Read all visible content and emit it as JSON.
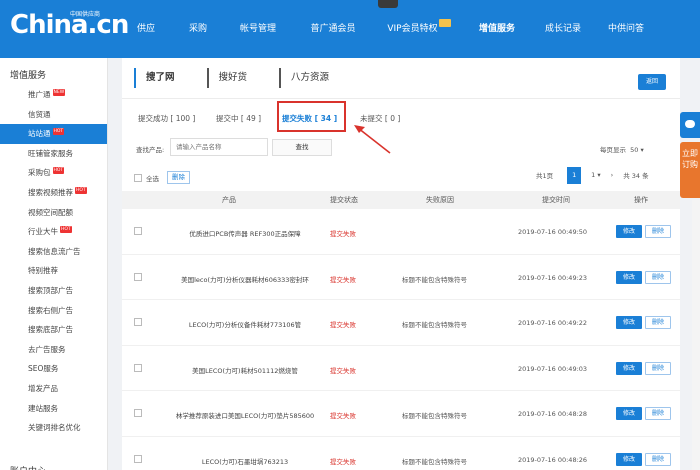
{
  "header": {
    "logo": "China.cn",
    "logo_sub": "中国供应商",
    "nav": [
      {
        "label": "供应",
        "bold": false
      },
      {
        "label": "采购",
        "bold": false
      },
      {
        "label": "帐号管理",
        "bold": false
      },
      {
        "label": "普广通会员",
        "bold": false
      },
      {
        "label": "VIP会员特权",
        "bold": false
      },
      {
        "label": "增值服务",
        "bold": true
      },
      {
        "label": "成长记录",
        "bold": false
      },
      {
        "label": "中供问答",
        "bold": false
      }
    ]
  },
  "sidebar": {
    "section_title": "增值服务",
    "items": [
      {
        "label": "推广通",
        "hot": "NEW",
        "active": false
      },
      {
        "label": "信贸通",
        "hot": "",
        "active": false
      },
      {
        "label": "站站通",
        "hot": "HOT",
        "active": true
      },
      {
        "label": "旺铺管家服务",
        "hot": "",
        "active": false
      },
      {
        "label": "采购包",
        "hot": "HOT",
        "active": false
      },
      {
        "label": "搜索视频推荐",
        "hot": "HOT",
        "active": false
      },
      {
        "label": "视频空间配额",
        "hot": "",
        "active": false
      },
      {
        "label": "行业大牛",
        "hot": "HOT",
        "active": false
      },
      {
        "label": "搜索信息流广告",
        "hot": "",
        "active": false
      },
      {
        "label": "特别推荐",
        "hot": "",
        "active": false
      },
      {
        "label": "搜索顶部广告",
        "hot": "",
        "active": false
      },
      {
        "label": "搜索右侧广告",
        "hot": "",
        "active": false
      },
      {
        "label": "搜索底部广告",
        "hot": "",
        "active": false
      },
      {
        "label": "去广告服务",
        "hot": "",
        "active": false
      },
      {
        "label": "SEO服务",
        "hot": "",
        "active": false
      },
      {
        "label": "增发产品",
        "hot": "",
        "active": false
      },
      {
        "label": "建站服务",
        "hot": "",
        "active": false
      },
      {
        "label": "关键词排名优化",
        "hot": "",
        "active": false
      }
    ],
    "bottom_section": "账户中心"
  },
  "main": {
    "tabs": [
      {
        "label": "搜了网",
        "active": true
      },
      {
        "label": "搜好货",
        "active": false
      },
      {
        "label": "八方资源",
        "active": false
      }
    ],
    "back_button": "返回",
    "subtabs": [
      {
        "label": "提交成功 [ 100 ]"
      },
      {
        "label": "提交中 [ 49 ]"
      },
      {
        "label": "提交失败 [ 34 ]"
      },
      {
        "label": "未提交 [ 0 ]"
      }
    ],
    "search": {
      "label": "查找产品:",
      "placeholder": "请输入产品名称",
      "button": "查找"
    },
    "per_page_label": "每页显示",
    "per_page_value": "50",
    "select_all_label": "全选",
    "bulk_delete": "删除",
    "pager": {
      "first": "共1页",
      "current": "1",
      "page_select": "1",
      "total": "共 34 条"
    },
    "table": {
      "headers": {
        "product": "产品",
        "status": "提交状态",
        "reason": "失败原因",
        "time": "提交时间",
        "op": "操作"
      },
      "rows": [
        {
          "product": "优质进口PCB传声器 REF300正品保障",
          "status": "提交失败",
          "reason": "",
          "time": "2019-07-16 00:49:50"
        },
        {
          "product": "美国leco(力可)分析仪器耗材606333密封环",
          "status": "提交失败",
          "reason": "标题不能包含特殊符号",
          "time": "2019-07-16 00:49:23"
        },
        {
          "product": "LECO(力可)分析仪备件耗材773106管",
          "status": "提交失败",
          "reason": "标题不能包含特殊符号",
          "time": "2019-07-16 00:49:22"
        },
        {
          "product": "美国LECO(力可)耗材501112燃烧管",
          "status": "提交失败",
          "reason": "",
          "time": "2019-07-16 00:49:03"
        },
        {
          "product": "林学推荐原装进口美国LECO(力可)垫片585600",
          "status": "提交失败",
          "reason": "标题不能包含特殊符号",
          "time": "2019-07-16 00:48:28"
        },
        {
          "product": "LECO(力可)石墨坩埚763213",
          "status": "提交失败",
          "reason": "标题不能包含特殊符号",
          "time": "2019-07-16 00:48:26"
        }
      ],
      "edit_label": "修改",
      "delete_label": "删除"
    }
  },
  "float": {
    "order_label": "立即订购"
  },
  "colors": {
    "brand": "#1a7fd6",
    "fail": "#d9332c",
    "highlight_box": "#d9332c",
    "order": "#e8762d"
  }
}
